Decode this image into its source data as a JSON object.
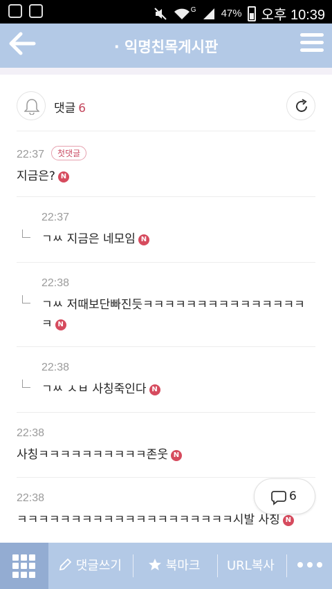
{
  "status_bar": {
    "battery": "47%",
    "time": "오후 10:39",
    "network": "G",
    "icons": [
      "app-icon",
      "image-icon",
      "mute-icon",
      "wifi-icon",
      "signal-icon",
      "battery-icon"
    ]
  },
  "header": {
    "title": "· 익명친목게시판",
    "back_icon": "back-arrow-icon",
    "menu_icon": "menu-icon",
    "bg_color": "#b3c9e6"
  },
  "comments_header": {
    "label": "댓글",
    "count": "6",
    "count_color": "#c4475d"
  },
  "comments": [
    {
      "time": "22:37",
      "badge": "첫댓글",
      "text": "지금은?",
      "reply": false
    },
    {
      "time": "22:37",
      "text": "ㄱㅆ 지금은 네모임",
      "reply": true
    },
    {
      "time": "22:38",
      "text": "ㄱㅆ 저때보단빠진듯ㅋㅋㅋㅋㅋㅋㅋㅋㅋㅋㅋㅋㅋㅋㅋㅋ",
      "reply": true
    },
    {
      "time": "22:38",
      "text": "ㄱㅆ ㅅㅂ 사칭죽인다",
      "reply": true
    },
    {
      "time": "22:38",
      "text": "사칭ㅋㅋㅋㅋㅋㅋㅋㅋㅋㅋ존웃",
      "reply": false
    },
    {
      "time": "22:38",
      "text": "ㅋㅋㅋㅋㅋㅋㅋㅋㅋㅋㅋㅋㅋㅋㅋㅋㅋㅋㅋㅋ시발 사칭",
      "reply": false
    }
  ],
  "new_badge": "N",
  "floating_button": {
    "count": "6",
    "icon": "comment-bubble-icon"
  },
  "bottom_bar": {
    "write_label": "댓글쓰기",
    "bookmark_label": "북마크",
    "url_copy_label": "URL복사",
    "icons": [
      "grid-icon",
      "pencil-icon",
      "star-icon",
      "more-icon"
    ]
  }
}
